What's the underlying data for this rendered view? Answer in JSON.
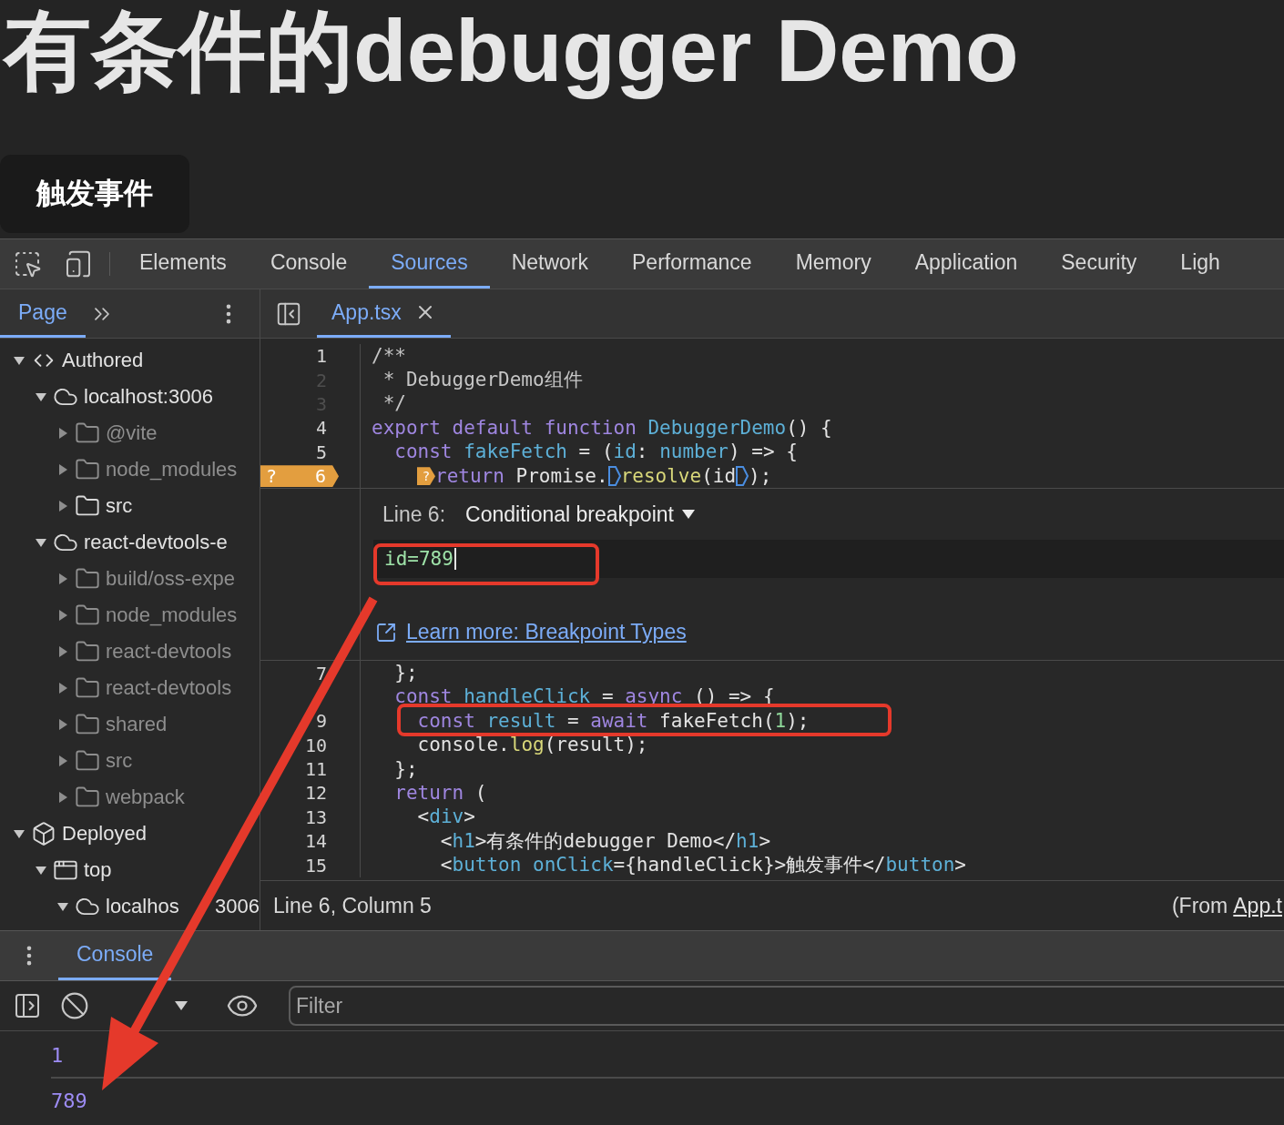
{
  "page": {
    "title": "有条件的debugger Demo",
    "button": "触发事件"
  },
  "devtools_tabs": [
    {
      "label": "Elements",
      "selected": false
    },
    {
      "label": "Console",
      "selected": false
    },
    {
      "label": "Sources",
      "selected": true
    },
    {
      "label": "Network",
      "selected": false
    },
    {
      "label": "Performance",
      "selected": false
    },
    {
      "label": "Memory",
      "selected": false
    },
    {
      "label": "Application",
      "selected": false
    },
    {
      "label": "Security",
      "selected": false
    },
    {
      "label": "Ligh",
      "selected": false
    }
  ],
  "navigator": {
    "tabs": [
      {
        "label": "Page",
        "selected": true
      }
    ],
    "tree": [
      {
        "kind": "section",
        "label": "Authored",
        "expanded": true,
        "children": [
          {
            "kind": "origin",
            "label": "localhost:3006",
            "expanded": true,
            "children": [
              {
                "kind": "folder",
                "label": "@vite",
                "expanded": false,
                "ignored": true
              },
              {
                "kind": "folder",
                "label": "node_modules",
                "expanded": false,
                "ignored": true
              },
              {
                "kind": "folder",
                "label": "src",
                "expanded": false,
                "ignored": false
              }
            ]
          },
          {
            "kind": "origin",
            "label": "react-devtools-e",
            "expanded": true,
            "children": [
              {
                "kind": "folder",
                "label": "build/oss-expe",
                "expanded": false,
                "ignored": true
              },
              {
                "kind": "folder",
                "label": "node_modules",
                "expanded": false,
                "ignored": true
              },
              {
                "kind": "folder",
                "label": "react-devtools",
                "expanded": false,
                "ignored": true
              },
              {
                "kind": "folder",
                "label": "react-devtools",
                "expanded": false,
                "ignored": true
              },
              {
                "kind": "folder",
                "label": "shared",
                "expanded": false,
                "ignored": true
              },
              {
                "kind": "folder",
                "label": "src",
                "expanded": false,
                "ignored": true
              },
              {
                "kind": "folder",
                "label": "webpack",
                "expanded": false,
                "ignored": true
              }
            ]
          }
        ]
      },
      {
        "kind": "section",
        "label": "Deployed",
        "expanded": true,
        "children": [
          {
            "kind": "frame",
            "label": "top",
            "expanded": true,
            "children": [
              {
                "kind": "origin",
                "label": "localhos",
                "label_tail": "3006",
                "expanded": true
              }
            ]
          }
        ]
      }
    ]
  },
  "editor": {
    "tabs": [
      {
        "label": "App.tsx",
        "selected": true
      }
    ],
    "lines_before": [
      {
        "number": "1",
        "dimmed": false,
        "tokens": [
          {
            "kind": "comment",
            "text": "/**"
          }
        ]
      },
      {
        "number": "2",
        "dimmed": true,
        "tokens": [
          {
            "kind": "comment",
            "text": " * DebuggerDemo组件"
          }
        ]
      },
      {
        "number": "3",
        "dimmed": true,
        "tokens": [
          {
            "kind": "comment",
            "text": " */"
          }
        ]
      },
      {
        "number": "4",
        "dimmed": false,
        "tokens": [
          {
            "kind": "keyword",
            "text": "export default function "
          },
          {
            "kind": "name",
            "text": "DebuggerDemo"
          },
          {
            "kind": "plain",
            "text": "() {"
          }
        ]
      },
      {
        "number": "5",
        "dimmed": false,
        "tokens": [
          {
            "kind": "keyword",
            "text": "  const "
          },
          {
            "kind": "name",
            "text": "fakeFetch"
          },
          {
            "kind": "plain",
            "text": " = ("
          },
          {
            "kind": "name",
            "text": "id"
          },
          {
            "kind": "plain",
            "text": ": "
          },
          {
            "kind": "name",
            "text": "number"
          },
          {
            "kind": "plain",
            "text": ") => {"
          }
        ]
      },
      {
        "number": "6",
        "dimmed": false,
        "breakpoint": {
          "label": "?"
        },
        "tokens": [
          {
            "kind": "conditional-marker",
            "text": "?"
          },
          {
            "kind": "keyword",
            "text": "return"
          },
          {
            "kind": "plain",
            "text": " Promise."
          },
          {
            "kind": "inline-marker"
          },
          {
            "kind": "call",
            "text": "resolve"
          },
          {
            "kind": "plain",
            "text": "(id"
          },
          {
            "kind": "inline-marker"
          },
          {
            "kind": "plain",
            "text": ");"
          }
        ]
      }
    ],
    "breakpoint_editor": {
      "line_label": "Line 6:",
      "type": "Conditional breakpoint",
      "value": "id=789",
      "link": "Learn more: Breakpoint Types"
    },
    "lines_after": [
      {
        "number": "7",
        "dimmed": false,
        "tokens": [
          {
            "kind": "plain",
            "text": "  };"
          }
        ]
      },
      {
        "tokens": [
          {
            "kind": "keyword",
            "text": "  const "
          },
          {
            "kind": "name",
            "text": "handleClick"
          },
          {
            "kind": "plain",
            "text": " = "
          },
          {
            "kind": "keyword",
            "text": "async"
          },
          {
            "kind": "plain",
            "text": " () => {"
          }
        ]
      },
      {
        "number": "9",
        "dimmed": false,
        "tokens": [
          {
            "kind": "keyword",
            "text": "    const "
          },
          {
            "kind": "name",
            "text": "result"
          },
          {
            "kind": "plain",
            "text": " = "
          },
          {
            "kind": "keyword",
            "text": "await"
          },
          {
            "kind": "plain",
            "text": " fakeFetch("
          },
          {
            "kind": "number",
            "text": "1"
          },
          {
            "kind": "plain",
            "text": ");"
          }
        ]
      },
      {
        "number": "10",
        "dimmed": false,
        "tokens": [
          {
            "kind": "plain",
            "text": "    console."
          },
          {
            "kind": "call",
            "text": "log"
          },
          {
            "kind": "plain",
            "text": "(result);"
          }
        ]
      },
      {
        "number": "11",
        "dimmed": false,
        "tokens": [
          {
            "kind": "plain",
            "text": "  };"
          }
        ]
      },
      {
        "number": "12",
        "dimmed": false,
        "tokens": [
          {
            "kind": "keyword",
            "text": "  return"
          },
          {
            "kind": "plain",
            "text": " ("
          }
        ]
      },
      {
        "number": "13",
        "dimmed": false,
        "tokens": [
          {
            "kind": "plain",
            "text": "    <"
          },
          {
            "kind": "name",
            "text": "div"
          },
          {
            "kind": "plain",
            "text": ">"
          }
        ]
      },
      {
        "number": "14",
        "dimmed": false,
        "tokens": [
          {
            "kind": "plain",
            "text": "      <"
          },
          {
            "kind": "name",
            "text": "h1"
          },
          {
            "kind": "plain",
            "text": ">有条件的debugger Demo</"
          },
          {
            "kind": "name",
            "text": "h1"
          },
          {
            "kind": "plain",
            "text": ">"
          }
        ]
      },
      {
        "number": "15",
        "dimmed": false,
        "tokens": [
          {
            "kind": "plain",
            "text": "      <"
          },
          {
            "kind": "name",
            "text": "button onClick"
          },
          {
            "kind": "plain",
            "text": "={handleClick}>触发事件</"
          },
          {
            "kind": "name",
            "text": "button"
          },
          {
            "kind": "plain",
            "text": ">"
          }
        ]
      }
    ],
    "status": {
      "position": "Line 6, Column 5",
      "source_prefix": "(From",
      "source_link": "App.t"
    }
  },
  "drawer": {
    "tabs": [
      {
        "label": "Console",
        "selected": true
      }
    ],
    "filter": {
      "placeholder": "Filter"
    },
    "messages": [
      "1",
      "789"
    ]
  }
}
